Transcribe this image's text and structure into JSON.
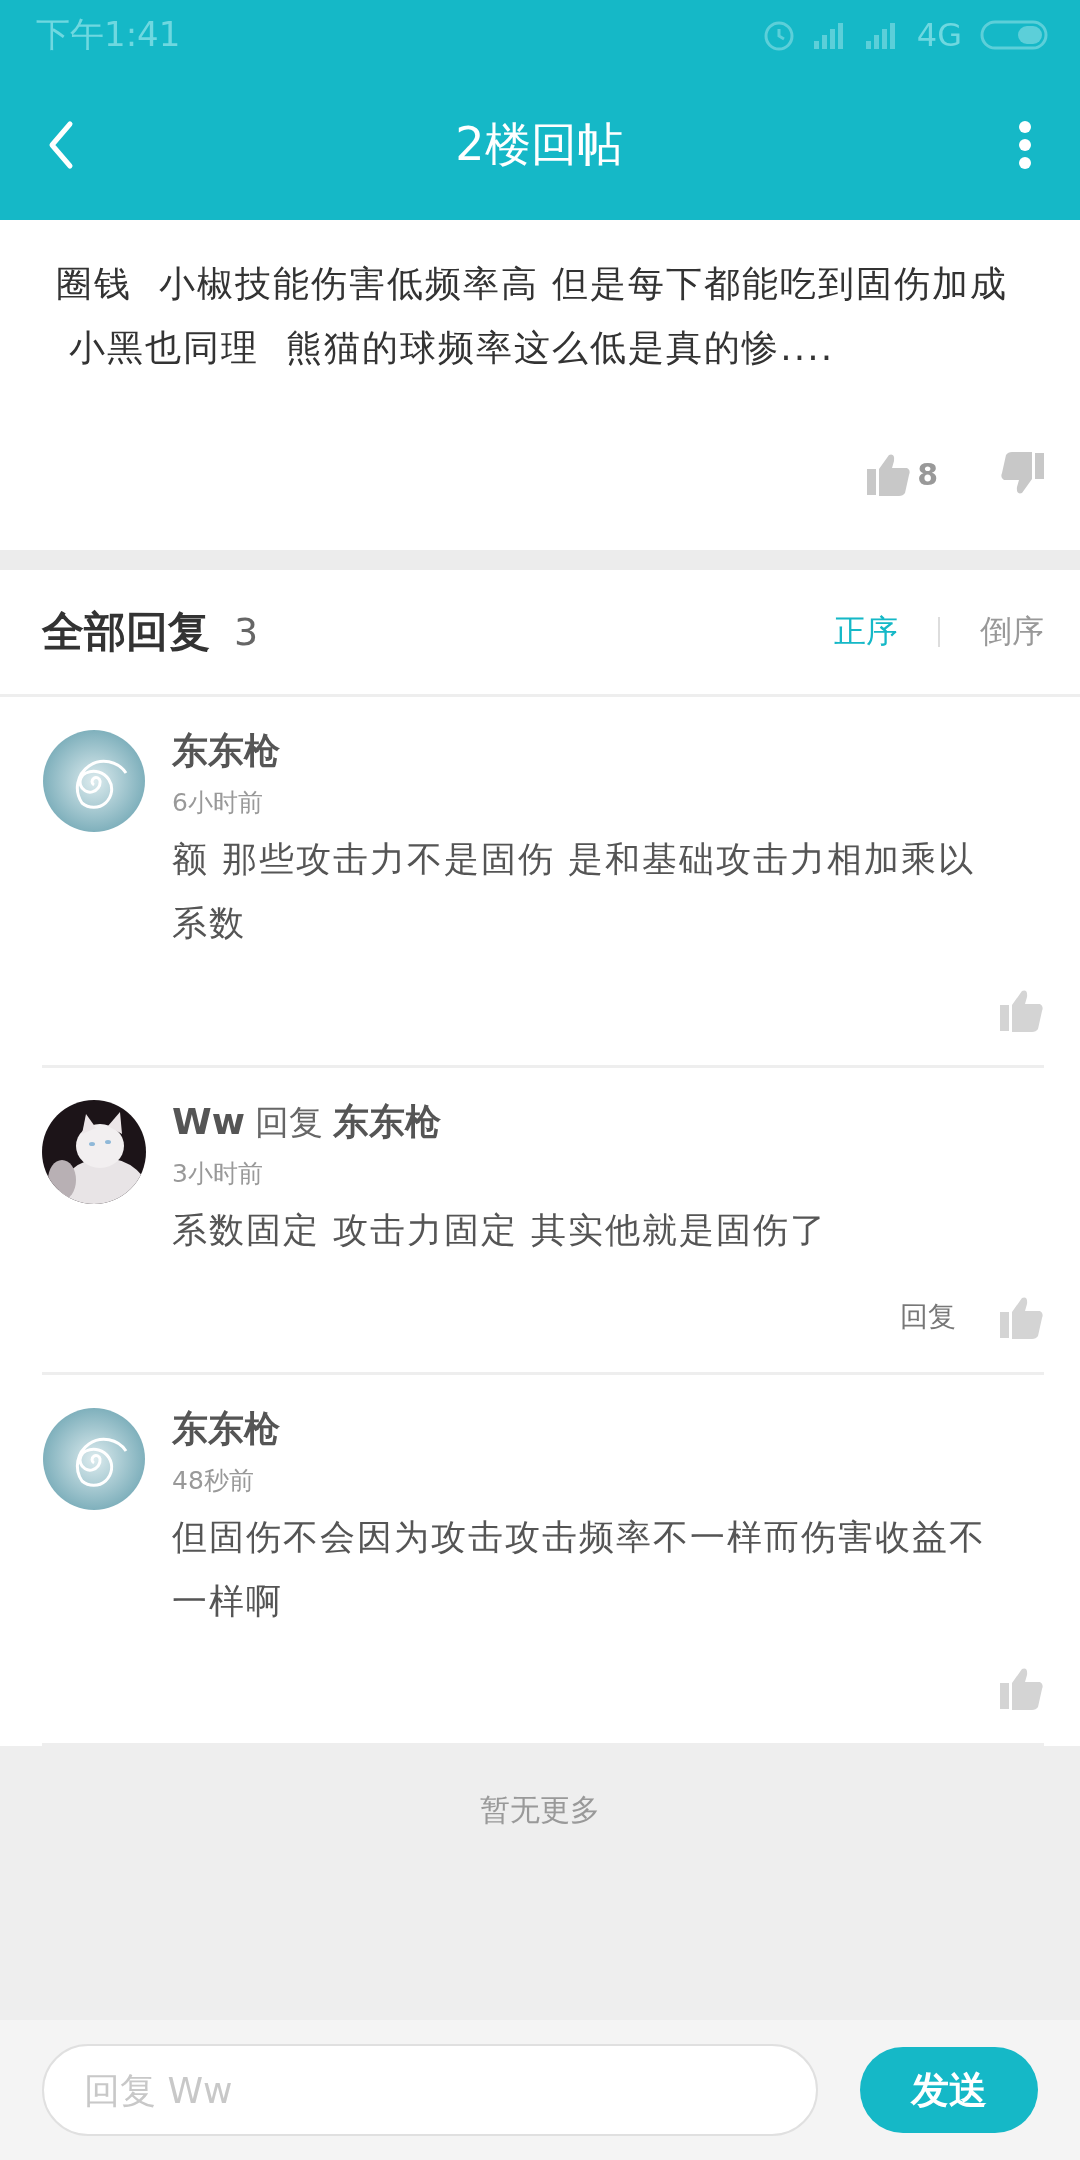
{
  "status_bar": {
    "time": "下午1:41",
    "network": "4G"
  },
  "app_bar": {
    "title": "2楼回帖"
  },
  "post": {
    "lines": [
      "圈钱  小椒技能伤害低频率高 但是每下都能吃到固伤加成",
      " 小黑也同理  熊猫的球频率这么低是真的惨...."
    ],
    "likes": "8"
  },
  "replies_header": {
    "title": "全部回复",
    "count": "3",
    "sort_options": [
      {
        "label": "正序",
        "selected": true
      },
      {
        "label": "倒序",
        "selected": false
      }
    ]
  },
  "replies": [
    {
      "avatar": {
        "kind": "spiral"
      },
      "author": "东东枪",
      "time": "6小时前",
      "lines": [
        "额 那些攻击力不是固伤 是和基础攻击力相加乘以",
        "系数"
      ]
    },
    {
      "avatar": {
        "kind": "picture"
      },
      "author": "Ww",
      "reply_word": "回复",
      "reply_to": "东东枪",
      "time": "3小时前",
      "lines": [
        "系数固定 攻击力固定 其实他就是固伤了"
      ],
      "reply_action": "回复"
    },
    {
      "avatar": {
        "kind": "spiral"
      },
      "author": "东东枪",
      "time": "48秒前",
      "lines": [
        "但固伤不会因为攻击攻击频率不一样而伤害收益不",
        "一样啊"
      ]
    }
  ],
  "footer": {
    "text": "暂无更多"
  },
  "composer": {
    "placeholder": "回复 Ww",
    "send_button": "发送"
  }
}
